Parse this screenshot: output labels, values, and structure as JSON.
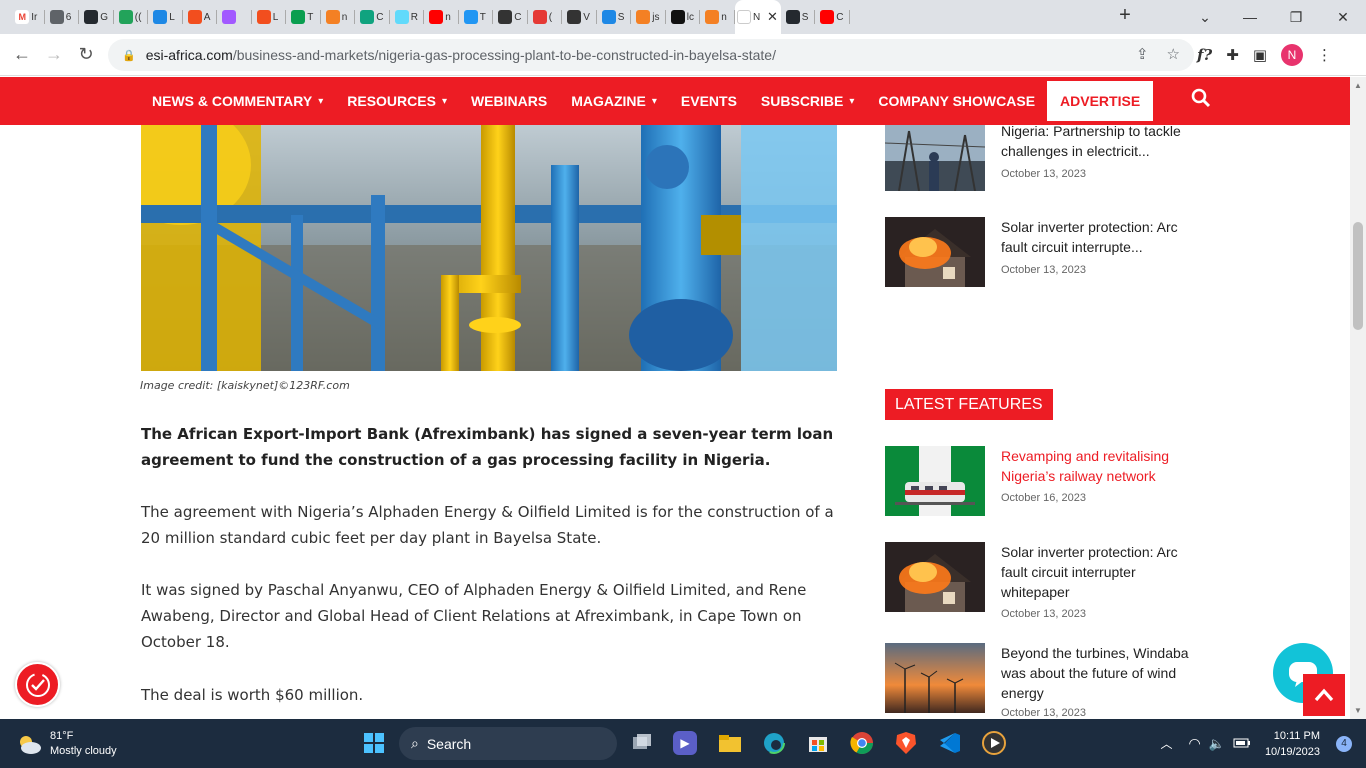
{
  "browser": {
    "tabs": [
      {
        "letter": "Ir",
        "color": "#ffffff",
        "icon": "gmail-icon"
      },
      {
        "letter": "6",
        "color": "#5f6368",
        "icon": "globe-icon"
      },
      {
        "letter": "G",
        "color": "#24292f",
        "icon": "github-icon"
      },
      {
        "letter": "((",
        "color": "#22a35a",
        "icon": "six-icon"
      },
      {
        "letter": "L",
        "color": "#1e88e5",
        "icon": "messenger-icon"
      },
      {
        "letter": "A",
        "color": "#f24e1e",
        "icon": "figma-icon"
      },
      {
        "letter": "",
        "color": "#a259ff",
        "icon": "figma-icon"
      },
      {
        "letter": "L",
        "color": "#f24e1e",
        "icon": "figma-icon"
      },
      {
        "letter": "T",
        "color": "#0a9e50",
        "icon": "map-pin-icon"
      },
      {
        "letter": "n",
        "color": "#f48024",
        "icon": "stackoverflow-icon"
      },
      {
        "letter": "C",
        "color": "#10a37f",
        "icon": "chatgpt-icon"
      },
      {
        "letter": "R",
        "color": "#61dafb",
        "icon": "react-icon"
      },
      {
        "letter": "n",
        "color": "#ff0000",
        "icon": "youtube-icon"
      },
      {
        "letter": "T",
        "color": "#2196f3",
        "icon": "diamond-icon"
      },
      {
        "letter": "C",
        "color": "#333333",
        "icon": "gatsby-icon"
      },
      {
        "letter": "(",
        "color": "#e53935",
        "icon": "nest-icon"
      },
      {
        "letter": "V",
        "color": "#333333",
        "icon": "graduation-icon"
      },
      {
        "letter": "S",
        "color": "#1e88e5",
        "icon": "triangle-icon"
      },
      {
        "letter": "js",
        "color": "#f48024",
        "icon": "stackoverflow-icon"
      },
      {
        "letter": "lc",
        "color": "#111111",
        "icon": "circle-a-icon"
      },
      {
        "letter": "n",
        "color": "#f48024",
        "icon": "stackoverflow-icon"
      },
      {
        "letter": "N",
        "color": "#ffffff",
        "icon": "active-tab-icon",
        "active": true
      },
      {
        "letter": "S",
        "color": "#24292f",
        "icon": "github-icon"
      },
      {
        "letter": "C",
        "color": "#ff0000",
        "icon": "youtube-icon"
      }
    ],
    "url_host": "esi-africa.com",
    "url_path": "/business-and-markets/nigeria-gas-processing-plant-to-be-constructed-in-bayelsa-state/",
    "profile_initial": "N"
  },
  "nav": {
    "items": [
      {
        "label": "NEWS & COMMENTARY",
        "dropdown": true
      },
      {
        "label": "RESOURCES",
        "dropdown": true
      },
      {
        "label": "WEBINARS",
        "dropdown": false
      },
      {
        "label": "MAGAZINE",
        "dropdown": true
      },
      {
        "label": "EVENTS",
        "dropdown": false
      },
      {
        "label": "SUBSCRIBE",
        "dropdown": true
      },
      {
        "label": "COMPANY SHOWCASE",
        "dropdown": false
      }
    ],
    "advertise": "ADVERTISE",
    "accent": "#ed1c24"
  },
  "article": {
    "image_credit": "Image credit: [kaiskynet]©123RF.com",
    "lead": "The African Export-Import Bank (Afreximbank) has signed a seven-year term loan agreement to fund the construction of a gas processing facility in Nigeria.",
    "paragraphs": [
      "The agreement with Nigeria’s Alphaden Energy & Oilfield Limited is for the construction of a 20 million standard cubic feet per day plant in Bayelsa State.",
      "It was signed by Paschal Anyanwu, CEO of Alphaden Energy & Oilfield Limited, and Rene Awabeng, Director and Global Head of Client Relations at Afreximbank, in Cape Town on October 18.",
      "The deal is worth $60 million."
    ]
  },
  "sidebar": {
    "top_items": [
      {
        "title": "Nigeria: Partnership to tackle challenges in electricit...",
        "date": "October 13, 2023"
      },
      {
        "title": "Solar inverter protection: Arc fault circuit interrupte...",
        "date": "October 13, 2023"
      }
    ],
    "latest_label": "LATEST FEATURES",
    "latest_items": [
      {
        "title": "Revamping and revitalising Nigeria’s railway network",
        "date": "October 16, 2023",
        "highlight": true
      },
      {
        "title": "Solar inverter protection: Arc fault circuit interrupter whitepaper",
        "date": "October 13, 2023",
        "highlight": false
      },
      {
        "title": "Beyond the turbines, Windaba was about the future of wind energy",
        "date": "October 13, 2023",
        "highlight": false
      }
    ]
  },
  "taskbar": {
    "temperature": "81°F",
    "condition": "Mostly cloudy",
    "search_label": "Search",
    "time": "10:11 PM",
    "date": "10/19/2023",
    "notifications": "4"
  }
}
